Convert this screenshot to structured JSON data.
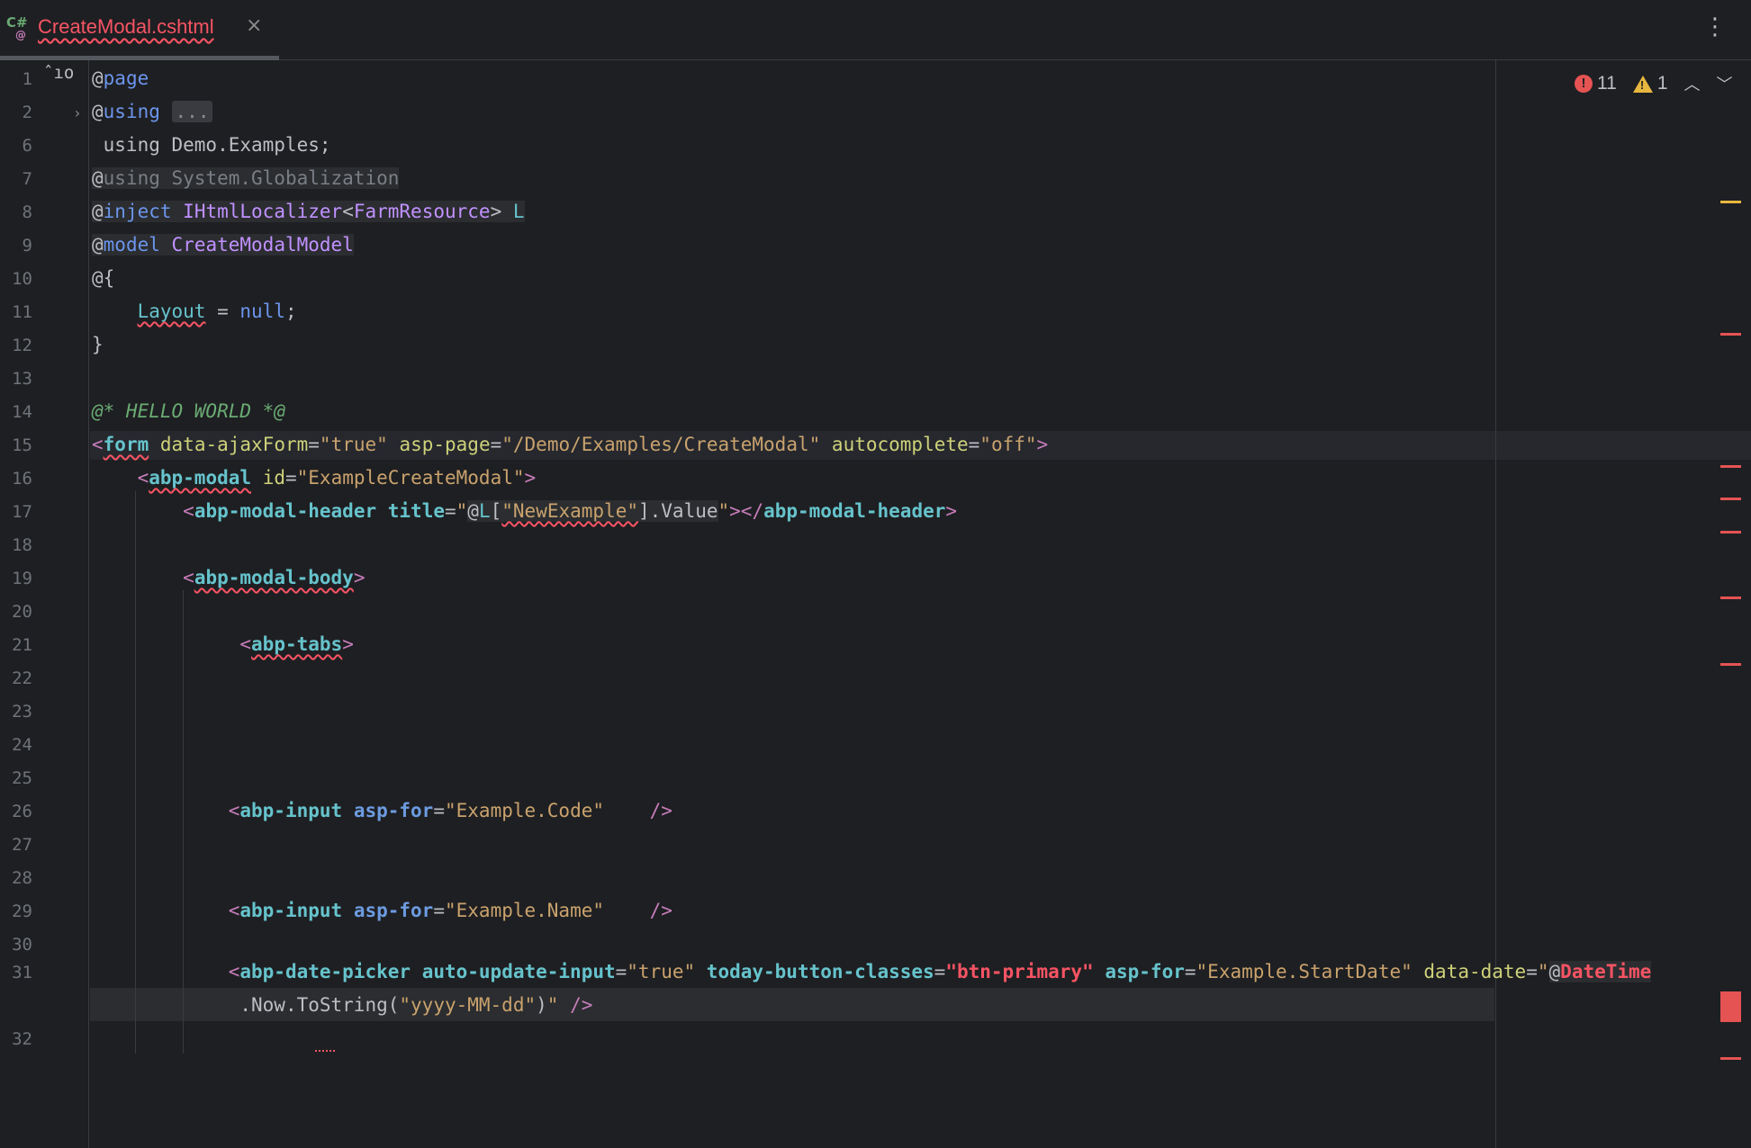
{
  "tab": {
    "icon_top": "C#",
    "icon_bottom": "@",
    "label": "CreateModal.cshtml",
    "close": "×"
  },
  "menu": {
    "more": "⋮"
  },
  "status": {
    "errors": "11",
    "warnings": "1",
    "error_icon": "!",
    "warning_icon": "!",
    "up": "︿",
    "down": "﹀"
  },
  "gutter_icon": "ˆıo",
  "fold_icon": "›",
  "line_numbers": [
    "1",
    "2",
    "6",
    "7",
    "8",
    "9",
    "10",
    "11",
    "12",
    "13",
    "14",
    "15",
    "16",
    "17",
    "18",
    "19",
    "20",
    "21",
    "22",
    "23",
    "24",
    "25",
    "26",
    "27",
    "28",
    "29",
    "30",
    "31",
    "32"
  ],
  "code": {
    "l1_page": "page",
    "l2_using": "using",
    "l2_fold": "...",
    "l6": " using Demo.Examples;",
    "l7_using": "using",
    "l7_ns": " System.Globalization",
    "l8_inject": "inject",
    "l8_type": "IHtmlLocalizer",
    "l8_generic": "FarmResource",
    "l8_var": "L",
    "l9_model": "model",
    "l9_type": "CreateModalModel",
    "l10": "@{",
    "l11_layout": "Layout",
    "l11_eq": " = ",
    "l11_null": "null",
    "l11_semi": ";",
    "l12": "}",
    "l14_comment": "@* HELLO WORLD *@",
    "l15_tag": "form",
    "l15_a1": "data-ajaxForm",
    "l15_v1": "\"true\"",
    "l15_a2": "asp-page",
    "l15_v2": "\"/Demo/Examples/CreateModal\"",
    "l15_a3": "autocomplete",
    "l15_v3": "\"off\"",
    "l16_tag": "abp-modal",
    "l16_a1": "id",
    "l16_v1": "\"ExampleCreateModal\"",
    "l17_tag": "abp-modal-header",
    "l17_a1": "title",
    "l17_key": "\"NewExample\"",
    "l17_value": ".Value",
    "l17_close": "abp-modal-header",
    "l19_tag": "abp-modal-body",
    "l21_tag": "abp-tabs",
    "l26_tag": "abp-input",
    "l26_a1": "asp-for",
    "l26_v1": "\"Example.Code\"",
    "l29_tag": "abp-input",
    "l29_a1": "asp-for",
    "l29_v1": "\"Example.Name\"",
    "l31_tag": "abp-date-picker",
    "l31_a1": "auto-update-input",
    "l31_v1": "\"true\"",
    "l31_a2": "today-button-classes",
    "l31_v2": "\"btn-primary\"",
    "l31_a3": "asp-for",
    "l31_v3": "\"Example.StartDate\"",
    "l31_a4": "data-date",
    "l31_v4": "\"",
    "l31_dt": "DateTime",
    "l31b_call": ".Now.ToString(",
    "l31b_fmt": "\"yyyy-MM-dd\"",
    "l31b_end": ")",
    "l31b_quote": "\"",
    "l31b_close": " />"
  }
}
